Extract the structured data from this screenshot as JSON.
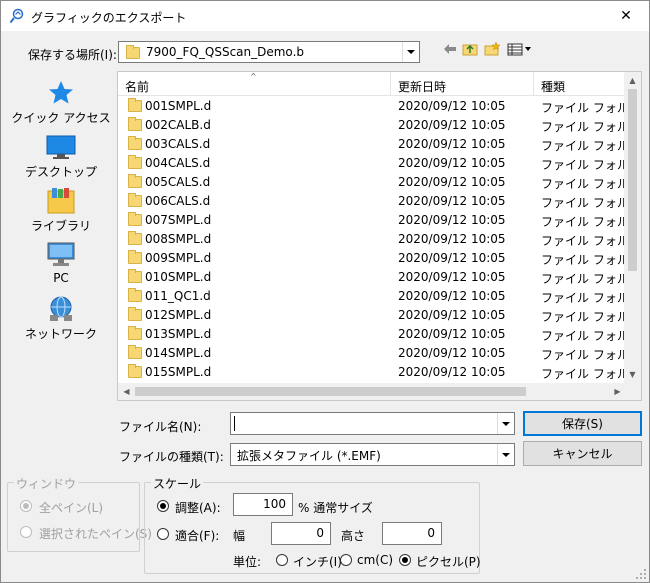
{
  "dialog": {
    "title": "グラフィックのエクスポート",
    "close_glyph": "✕"
  },
  "location": {
    "label": "保存する場所(I):",
    "value": "7900_FQ_QSScan_Demo.b"
  },
  "places": [
    {
      "label": "クイック アクセス",
      "icon": "quick-access-star-icon"
    },
    {
      "label": "デスクトップ",
      "icon": "desktop-icon"
    },
    {
      "label": "ライブラリ",
      "icon": "library-icon"
    },
    {
      "label": "PC",
      "icon": "pc-icon"
    },
    {
      "label": "ネットワーク",
      "icon": "network-icon"
    }
  ],
  "columns": {
    "name": "名前",
    "modified": "更新日時",
    "type": "種類"
  },
  "files": [
    {
      "name": "001SMPL.d",
      "modified": "2020/09/12 10:05",
      "type": "ファイル フォルダー"
    },
    {
      "name": "002CALB.d",
      "modified": "2020/09/12 10:05",
      "type": "ファイル フォルダー"
    },
    {
      "name": "003CALS.d",
      "modified": "2020/09/12 10:05",
      "type": "ファイル フォルダー"
    },
    {
      "name": "004CALS.d",
      "modified": "2020/09/12 10:05",
      "type": "ファイル フォルダー"
    },
    {
      "name": "005CALS.d",
      "modified": "2020/09/12 10:05",
      "type": "ファイル フォルダー"
    },
    {
      "name": "006CALS.d",
      "modified": "2020/09/12 10:05",
      "type": "ファイル フォルダー"
    },
    {
      "name": "007SMPL.d",
      "modified": "2020/09/12 10:05",
      "type": "ファイル フォルダー"
    },
    {
      "name": "008SMPL.d",
      "modified": "2020/09/12 10:05",
      "type": "ファイル フォルダー"
    },
    {
      "name": "009SMPL.d",
      "modified": "2020/09/12 10:05",
      "type": "ファイル フォルダー"
    },
    {
      "name": "010SMPL.d",
      "modified": "2020/09/12 10:05",
      "type": "ファイル フォルダー"
    },
    {
      "name": "011_QC1.d",
      "modified": "2020/09/12 10:05",
      "type": "ファイル フォルダー"
    },
    {
      "name": "012SMPL.d",
      "modified": "2020/09/12 10:05",
      "type": "ファイル フォルダー"
    },
    {
      "name": "013SMPL.d",
      "modified": "2020/09/12 10:05",
      "type": "ファイル フォルダー"
    },
    {
      "name": "014SMPL.d",
      "modified": "2020/09/12 10:05",
      "type": "ファイル フォルダー"
    },
    {
      "name": "015SMPL.d",
      "modified": "2020/09/12 10:05",
      "type": "ファイル フォルダー"
    }
  ],
  "filename": {
    "label": "ファイル名(N):",
    "value": ""
  },
  "filetype": {
    "label": "ファイルの種類(T):",
    "value": "拡張メタファイル (*.EMF)"
  },
  "buttons": {
    "save": "保存(S)",
    "cancel": "キャンセル"
  },
  "window_group": {
    "title": "ウィンドウ",
    "all_panes": "全ペイン(L)",
    "selected_pane": "選択されたペイン(S)"
  },
  "scale_group": {
    "title": "スケール",
    "adjust": "調整(A):",
    "adjust_value": "100",
    "adjust_suffix": "% 通常サイズ",
    "fit": "適合(F):",
    "width_label": "幅",
    "width_value": "0",
    "height_label": "高さ",
    "height_value": "0",
    "unit_label": "単位:",
    "unit_inch": "インチ(I)",
    "unit_cm": "cm(C)",
    "unit_pixel": "ピクセル(P)"
  }
}
